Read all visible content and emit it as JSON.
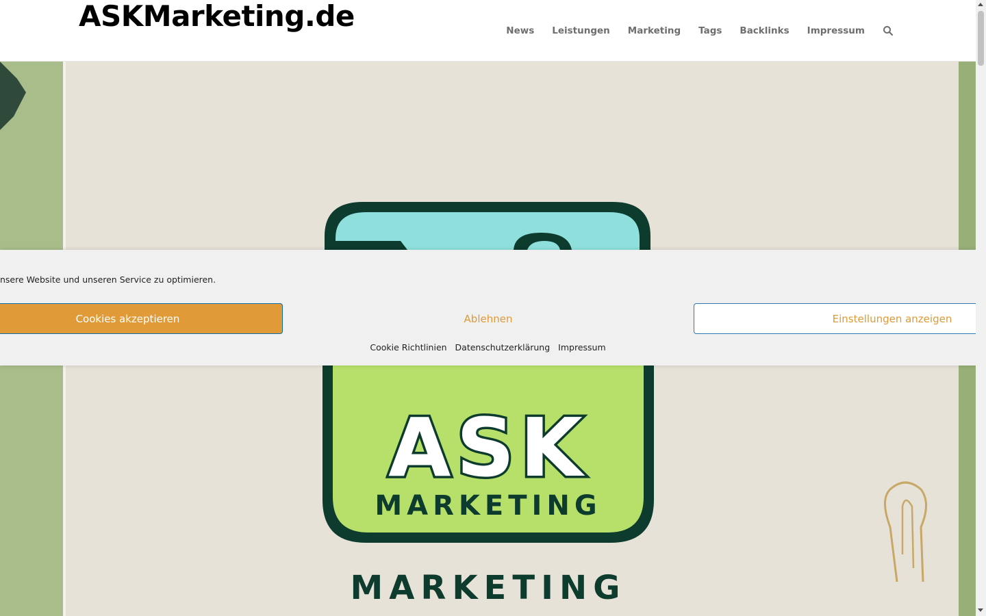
{
  "site": {
    "logo": "ASKMarketing.de"
  },
  "nav": {
    "items": [
      "News",
      "Leistungen",
      "Marketing",
      "Tags",
      "Backlinks",
      "Impressum"
    ],
    "search_icon": "search-icon"
  },
  "hero": {
    "logo_text_main": "ASK",
    "logo_text_sub": "MARKETING",
    "caption": "MARKETING",
    "colors": {
      "card": "#e6e2d8",
      "badge_green": "#b6e06a",
      "badge_teal": "#8fe0dc",
      "outline": "#0d3b2e",
      "side_green": "#a9bd8a"
    }
  },
  "cookie": {
    "message": "nsere Website und unseren Service zu optimieren.",
    "accept_label": "Cookies akzeptieren",
    "deny_label": "Ablehnen",
    "settings_label": "Einstellungen anzeigen",
    "links": [
      "Cookie Richtlinien",
      "Datenschutzerklärung",
      "Impressum"
    ],
    "colors": {
      "accent": "#e09a37",
      "border": "#0b6aa8",
      "background": "#f0f0f0"
    }
  }
}
